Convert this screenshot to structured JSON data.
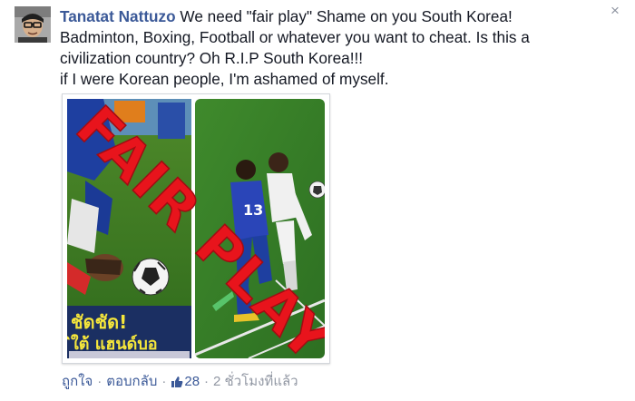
{
  "comment": {
    "author": "Tanatat Nattuzo",
    "lines": [
      " We need \"fair play\" Shame on you South Korea!",
      "Badminton, Boxing, Football or whatever you want to cheat. Is this a",
      "civilization country? Oh R.I.P South Korea!!!",
      "if I were Korean people, I'm ashamed of myself."
    ],
    "image": {
      "overlay_text": "FAIR PLAY",
      "caption_line1": "ชัดชัด!",
      "caption_line2": "ิใต้ แฮนด์บอ",
      "jersey_number": "13",
      "icon": "photo-collage"
    },
    "actions": {
      "like": "ถูกใจ",
      "reply": "ตอบกลับ",
      "like_count": "28",
      "time": "2 ชั่วโมงที่แล้ว"
    },
    "close_icon": "×"
  },
  "colors": {
    "author": "#3b5998",
    "text": "#141823",
    "meta": "#9197a3",
    "overlay_red": "#e8141c"
  }
}
